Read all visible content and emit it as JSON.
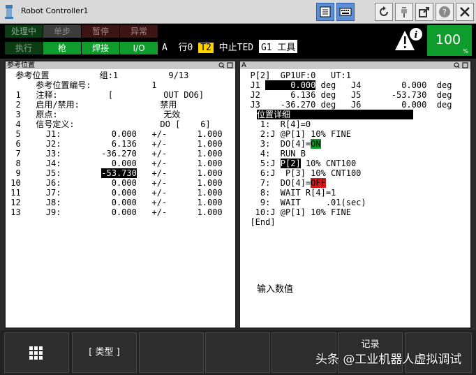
{
  "window": {
    "title": "Robot Controller1"
  },
  "status_lamps": [
    {
      "label": "处理中",
      "state": "dark-green"
    },
    {
      "label": "单步",
      "state": "dark-gray"
    },
    {
      "label": "暂停",
      "state": "dark-red"
    },
    {
      "label": "异常",
      "state": "dark-red"
    },
    {
      "label": "执行",
      "state": "dark-green"
    },
    {
      "label": "枪",
      "state": "on-green"
    },
    {
      "label": "焊接",
      "state": "on-green"
    },
    {
      "label": "I/O",
      "state": "on-green"
    }
  ],
  "status": {
    "prefix": "A  行0",
    "mode": "T2",
    "state": "中止TED",
    "frame": "G1 工具"
  },
  "speed": {
    "value": "100",
    "unit": "%"
  },
  "colors": {
    "lamp_on": "#0e9c2c",
    "mode_badge": "#ffd200",
    "do_on": "#0c9c2a",
    "do_off": "#d41a1a",
    "title_button_selected": "#5c8fd6"
  },
  "left_panel": {
    "header": "参考位置",
    "lines": [
      "  参考位置          组:1          9/13",
      "      参考位置编号:            1",
      "  1   注释:          [          OUT DO6]",
      "  2   启用/禁用:                禁用",
      "  3   原点:                     无效",
      "  4   信号定义:                 DO [    6]",
      "  5     J1:          0.000   +/-      1.000",
      "  6     J2:          6.136   +/-      1.000",
      "  7     J3:        -36.270   +/-      1.000",
      "  8     J4:          0.000   +/-      1.000",
      "  9     J5:        ",
      " 10     J6:          0.000   +/-      1.000",
      " 11     J7:          0.000   +/-      1.000",
      " 12     J8:          0.000   +/-      1.000",
      " 13     J9:          0.000   +/-      1.000"
    ],
    "selected_value": "-53.730",
    "selected_tail": "   +/-      1.000"
  },
  "right_panel": {
    "header": "A",
    "pos_header": "  P[2]  GP1UF:0   UT:1",
    "joints": [
      {
        "prefix": "  J1 ",
        "value": "     0.000",
        "suffix": " deg   J4        0.000  deg"
      },
      {
        "prefix": "  J2 ",
        "value": "     6.136",
        "suffix": " deg   J5      -53.730  deg"
      },
      {
        "prefix": "  J3 ",
        "value": "   -36.270",
        "suffix": " deg   J6        0.000  deg"
      }
    ],
    "section_title": "位置详细",
    "program": [
      "    1:  R[4]=0",
      "    2:J @P[1] 10% FINE",
      "    3:  DO[4]=",
      "    4:  RUN B",
      "    5:J ",
      "    6:J  P[3] 10% CNT100",
      "    7:  DO[4]=",
      "    8:  WAIT R[4]=1",
      "    9:  WAIT     .01(sec)",
      "   10:J @P[1] 10% FINE",
      "  [End]"
    ],
    "do_on_label": "ON",
    "do_off_label": "OFF",
    "cursor_point": "P[2]",
    "line5_tail": " 10% CNT100",
    "prompt": "输入数值"
  },
  "function_keys": [
    {
      "label": "grid-icon"
    },
    {
      "label": "[ 类型 ]"
    },
    {
      "label": ""
    },
    {
      "label": ""
    },
    {
      "label": ""
    },
    {
      "label": "记录"
    },
    {
      "label": ""
    }
  ],
  "watermark": "头条 @工业机器人虚拟调试"
}
